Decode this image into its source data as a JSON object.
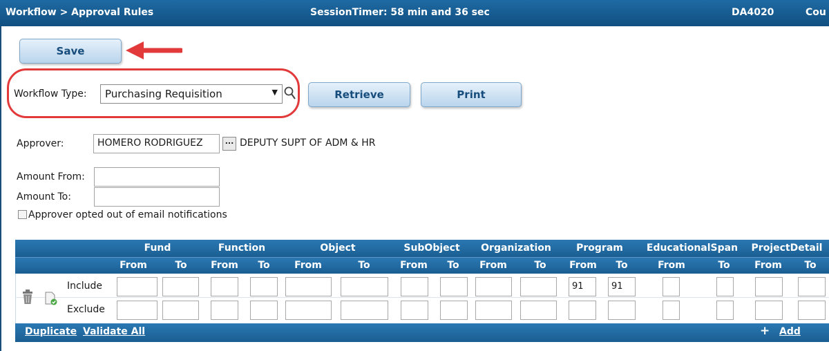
{
  "header": {
    "breadcrumb": "Workflow > Approval Rules",
    "session_timer": "SessionTimer: 58 min and 36 sec",
    "page_code": "DA4020",
    "truncated": "Cou"
  },
  "toolbar": {
    "save_label": "Save"
  },
  "workflow": {
    "label": "Workflow Type:",
    "selected": "Purchasing Requisition",
    "retrieve_label": "Retrieve",
    "print_label": "Print"
  },
  "approver": {
    "label": "Approver:",
    "name": "HOMERO RODRIGUEZ",
    "ellipsis": "...",
    "title": "DEPUTY SUPT OF ADM & HR"
  },
  "amounts": {
    "from_label": "Amount From:",
    "from_value": "",
    "to_label": "Amount To:",
    "to_value": ""
  },
  "opt_out": {
    "label": "Approver opted out of email notifications",
    "checked": false
  },
  "table": {
    "groups": [
      "Fund",
      "Function",
      "Object",
      "SubObject",
      "Organization",
      "Program",
      "EducationalSpan",
      "ProjectDetail"
    ],
    "sub": {
      "from": "From",
      "to": "To"
    },
    "rows": [
      {
        "label": "Include",
        "program_from": "91",
        "program_to": "91"
      },
      {
        "label": "Exclude",
        "program_from": "",
        "program_to": ""
      }
    ]
  },
  "footer": {
    "duplicate_label": "Duplicate",
    "validate_label": "Validate All",
    "add_symbol": "+",
    "add_label": "Add"
  },
  "colors": {
    "header_blue": "#1a5e92",
    "callout_red": "#e23a3a",
    "button_text": "#174d7c"
  }
}
